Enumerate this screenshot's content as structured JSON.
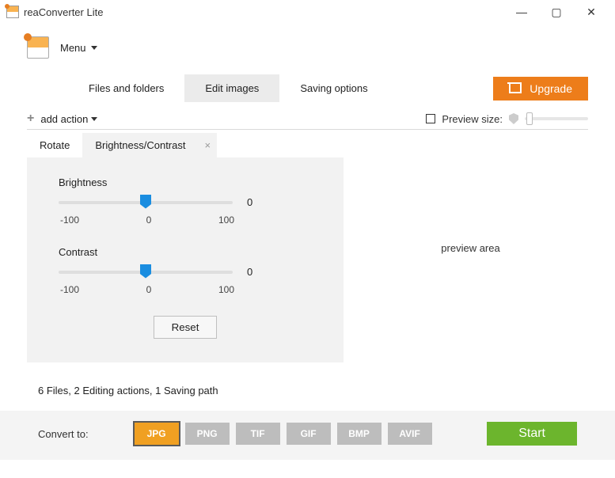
{
  "window": {
    "title": "reaConverter Lite"
  },
  "menu": {
    "label": "Menu"
  },
  "topnav": {
    "files": "Files and folders",
    "edit": "Edit images",
    "saving": "Saving options",
    "upgrade": "Upgrade"
  },
  "actionbar": {
    "add": "add action",
    "preview_size": "Preview size:"
  },
  "panel": {
    "tabs": {
      "rotate": "Rotate",
      "bc": "Brightness/Contrast"
    },
    "brightness": {
      "label": "Brightness",
      "value": "0",
      "min": "-100",
      "mid": "0",
      "max": "100"
    },
    "contrast": {
      "label": "Contrast",
      "value": "0",
      "min": "-100",
      "mid": "0",
      "max": "100"
    },
    "reset": "Reset"
  },
  "preview": {
    "label": "preview area"
  },
  "status": {
    "text": "6 Files, 2 Editing actions, 1 Saving path"
  },
  "footer": {
    "convert_label": "Convert to:",
    "formats": {
      "jpg": "JPG",
      "png": "PNG",
      "tif": "TIF",
      "gif": "GIF",
      "bmp": "BMP",
      "avif": "AVIF"
    },
    "start": "Start"
  }
}
